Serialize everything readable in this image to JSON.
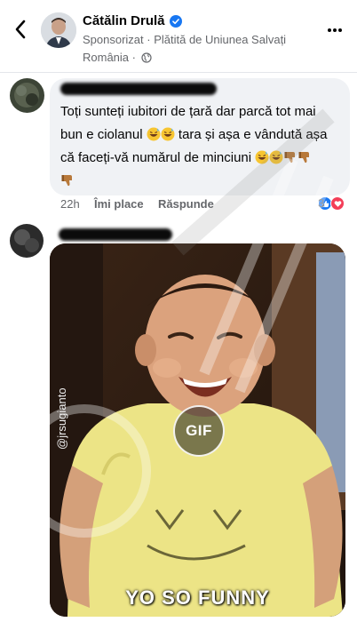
{
  "header": {
    "name": "Cătălin Drulă",
    "sub_line1": "Sponsorizat · Plătită de Uniunea Salvați",
    "sub_line2": "România ·",
    "icons": {
      "back": "chevron-left-icon",
      "verified": "verified-badge-icon",
      "globe": "globe-icon",
      "more": "more-horizontal-icon"
    }
  },
  "comment1": {
    "line1": "Toți sunteți iubitori de țară dar parcă tot mai",
    "line2_a": "bun e ciolanul",
    "line2_b": "tara și așa e vândută așa",
    "line3": "că faceți-vă numărul de minciuni",
    "emojis": [
      "grinning-sweat-emoji",
      "thumbs-down-emoji"
    ],
    "time": "22h",
    "like_label": "Îmi place",
    "reply_label": "Răspunde",
    "reaction_count": "3",
    "reactions": [
      "like-icon",
      "love-icon"
    ]
  },
  "comment2": {
    "gif_label": "GIF",
    "gif_caption": "YO SO FUNNY",
    "gif_handle": "@jrsugianto"
  },
  "colors": {
    "accent": "#1877f2",
    "bubble": "#f0f2f5",
    "secondary_text": "#65676b",
    "love": "#f33e58"
  }
}
